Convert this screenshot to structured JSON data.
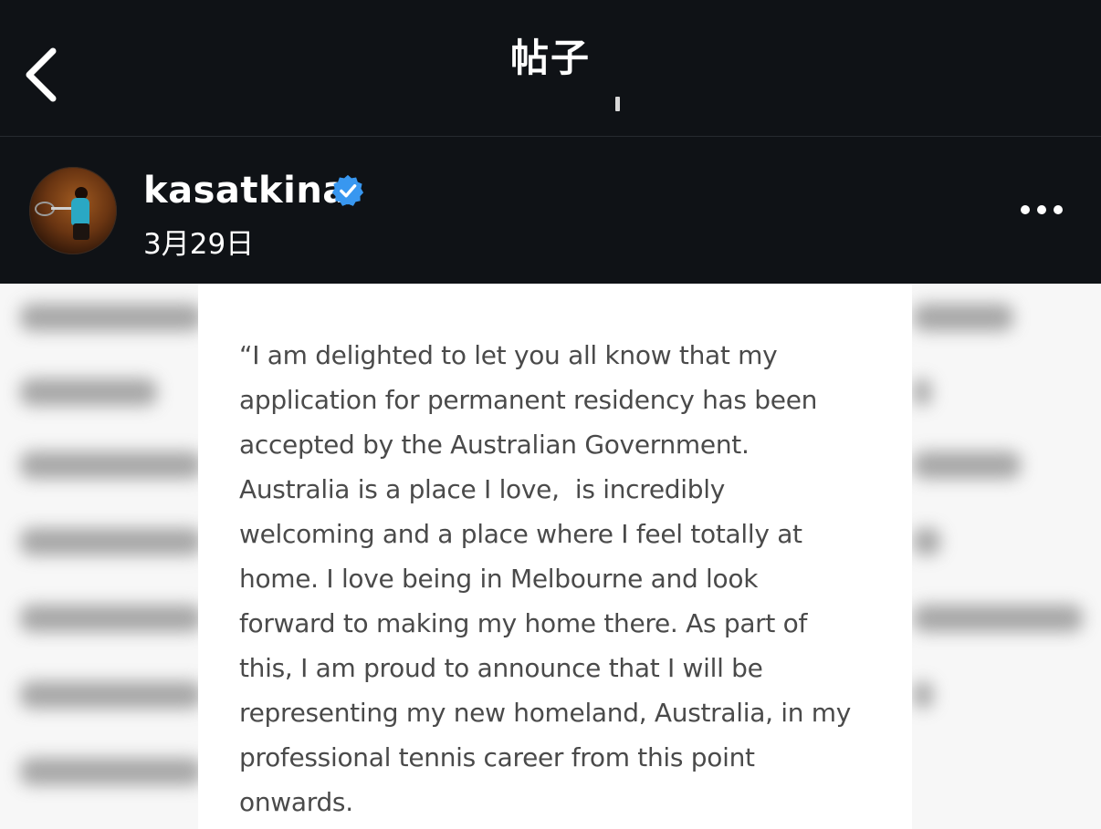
{
  "header": {
    "title": "帖子"
  },
  "post": {
    "username": "kasatkina",
    "date": "3月29日"
  },
  "statement": {
    "lines": [
      "“I am delighted to let you all know that my",
      "application for permanent residency has been",
      "accepted by the Australian Government.",
      "Australia is a place I love,  is incredibly",
      "welcoming and a place where I feel totally at",
      "home. I love being in Melbourne and look",
      "forward to making my home there. As part of",
      "this, I am proud to announce that I will be",
      "representing my new homeland, Australia, in my",
      "professional tennis career from this point",
      "onwards."
    ]
  },
  "icons": {
    "back": "chevron-left-icon",
    "verified": "verified-badge-icon",
    "more": "more-horizontal-icon"
  },
  "colors": {
    "bar_background": "#0f1216",
    "verified_blue": "#3897f0",
    "statement_text": "#4a4a4a"
  }
}
